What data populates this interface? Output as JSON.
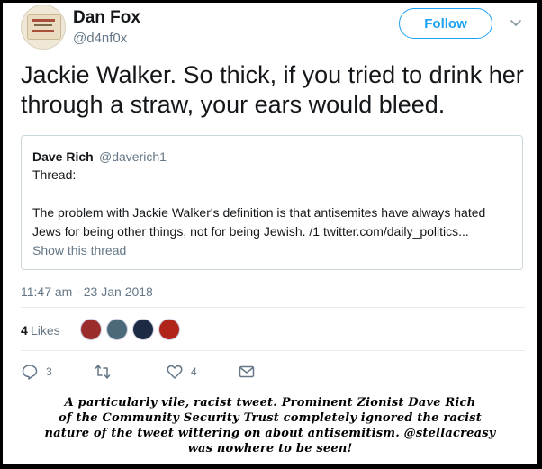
{
  "author": {
    "name": "Dan Fox",
    "handle": "@d4nf0x"
  },
  "follow_label": "Follow",
  "tweet_text": "Jackie Walker. So thick, if you tried to drink her through a straw, your ears would bleed.",
  "quoted": {
    "name": "Dave Rich",
    "handle": "@daverich1",
    "thread_label": "Thread:",
    "body": "The problem with Jackie Walker's definition is that antisemites have always hated Jews for being other things, not for being Jewish. /1 twitter.com/daily_politics...",
    "show_thread": "Show this thread"
  },
  "timestamp": "11:47 am - 23 Jan 2018",
  "likes": {
    "count": "4",
    "label": "Likes"
  },
  "likers": [
    {
      "name": "liker-1",
      "color": "#9b2c2c"
    },
    {
      "name": "liker-2",
      "color": "#4a6a7a"
    },
    {
      "name": "liker-3",
      "color": "#1c2a44"
    },
    {
      "name": "liker-4",
      "color": "#b0241a"
    }
  ],
  "actions": {
    "reply_count": "3",
    "retweet_count": "",
    "like_count": "4"
  },
  "accent_color": "#1da1f2",
  "caption_lines": [
    "A particularly vile, racist tweet. Prominent Zionist Dave Rich",
    "of the Community Security Trust completely ignored the racist",
    "nature of the tweet wittering on about antisemitism. @stellacreasy",
    "was nowhere to be seen!"
  ]
}
